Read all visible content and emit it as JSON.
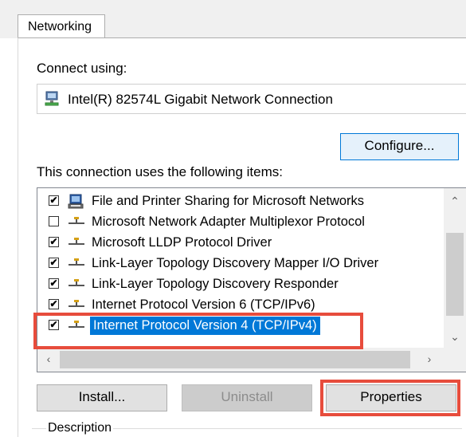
{
  "tabs": [
    {
      "label": "Networking",
      "active": true
    }
  ],
  "connect_using": {
    "label": "Connect using:",
    "adapter_name": "Intel(R) 82574L Gigabit Network Connection",
    "configure_label": "Configure..."
  },
  "items_section": {
    "label": "This connection uses the following items:",
    "items": [
      {
        "label": "File and Printer Sharing for Microsoft Networks",
        "checked": true,
        "icon": "file-printer-sharing-icon"
      },
      {
        "label": "Microsoft Network Adapter Multiplexor Protocol",
        "checked": false,
        "icon": "network-protocol-icon"
      },
      {
        "label": "Microsoft LLDP Protocol Driver",
        "checked": true,
        "icon": "network-protocol-icon"
      },
      {
        "label": "Link-Layer Topology Discovery Mapper I/O Driver",
        "checked": true,
        "icon": "network-protocol-icon"
      },
      {
        "label": "Link-Layer Topology Discovery Responder",
        "checked": true,
        "icon": "network-protocol-icon"
      },
      {
        "label": "Internet Protocol Version 6 (TCP/IPv6)",
        "checked": true,
        "icon": "network-protocol-icon"
      },
      {
        "label": "Internet Protocol Version 4 (TCP/IPv4)",
        "checked": true,
        "icon": "network-protocol-icon",
        "selected": true
      }
    ]
  },
  "buttons": {
    "install": "Install...",
    "uninstall": "Uninstall",
    "properties": "Properties"
  },
  "description_label": "Description",
  "colors": {
    "selection": "#0078d7",
    "highlight_annotation": "#e74c3c"
  }
}
